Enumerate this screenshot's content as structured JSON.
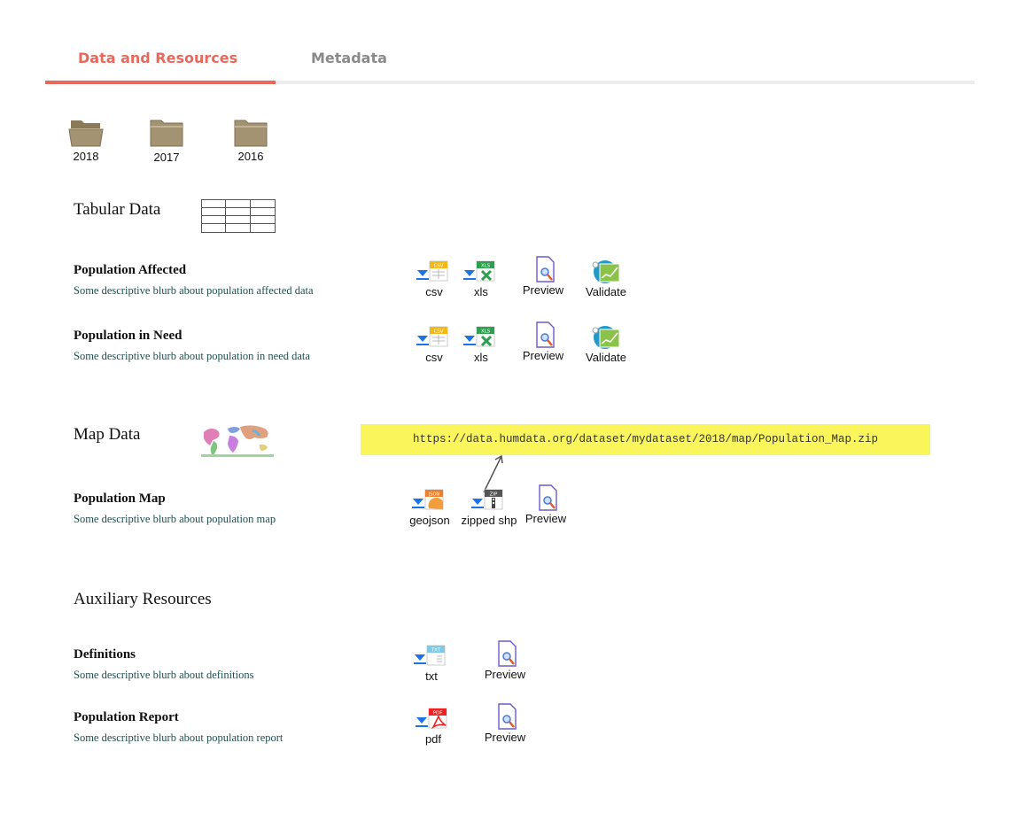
{
  "tabs": [
    {
      "label": "Data and Resources",
      "active": true
    },
    {
      "label": "Metadata",
      "active": false
    }
  ],
  "colors": {
    "accent": "#e8695b",
    "url_highlight": "#f9f55a",
    "folder": "#a39372"
  },
  "folders": [
    {
      "label": "2018",
      "icon": "folder-open-icon"
    },
    {
      "label": "2017",
      "icon": "folder-icon"
    },
    {
      "label": "2016",
      "icon": "folder-icon"
    }
  ],
  "sections": {
    "tabular": {
      "title": "Tabular Data",
      "icon": "table-icon"
    },
    "map": {
      "title": "Map Data",
      "icon": "world-map-icon",
      "url": "https://data.humdata.org/dataset/mydataset/2018/map/Population_Map.zip"
    },
    "auxiliary": {
      "title": "Auxiliary Resources"
    }
  },
  "resources": [
    {
      "title": "Population Affected",
      "desc": "Some descriptive blurb about population affected data",
      "actions": [
        "csv",
        "xls",
        "Preview",
        "Validate"
      ]
    },
    {
      "title": "Population in Need",
      "desc": "Some descriptive blurb about population in need data",
      "actions": [
        "csv",
        "xls",
        "Preview",
        "Validate"
      ]
    },
    {
      "title": "Population Map",
      "desc": "Some descriptive blurb about population map",
      "actions": [
        "geojson",
        "zipped shp",
        "Preview"
      ]
    },
    {
      "title": "Definitions",
      "desc": "Some descriptive blurb about definitions",
      "actions": [
        "txt",
        "Preview"
      ]
    },
    {
      "title": "Population Report",
      "desc": "Some descriptive blurb about population report",
      "actions": [
        "pdf",
        "Preview"
      ]
    }
  ],
  "file_badges": {
    "csv": "CSV",
    "xls": "XLS",
    "geojson": "JSON",
    "zip": "ZIP",
    "txt": "TXT",
    "pdf": "PDF"
  }
}
